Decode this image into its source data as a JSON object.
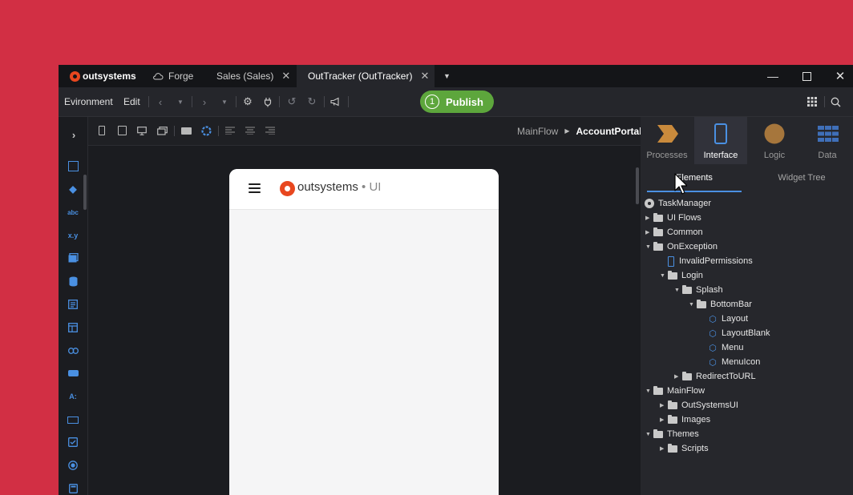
{
  "titlebar": {
    "brand": "outsystems",
    "tabs": [
      {
        "label": "Forge"
      },
      {
        "label": "Sales (Sales)"
      },
      {
        "label": "OutTracker (OutTracker)"
      }
    ]
  },
  "toolbar": {
    "environment_label": "Evironment",
    "edit_label": "Edit",
    "publish_number": "1",
    "publish_label": "Publish"
  },
  "breadcrumb": {
    "flow": "MainFlow",
    "screen": "AccountPortal"
  },
  "device": {
    "logo_text": "outsystems",
    "logo_suffix": " • UI"
  },
  "right_panel": {
    "tabs": [
      {
        "label": "Processes",
        "color": "#c98a3c"
      },
      {
        "label": "Interface",
        "color": "#4a90e2"
      },
      {
        "label": "Logic",
        "color": "#a6763c"
      },
      {
        "label": "Data",
        "color": "#3f6fb8"
      }
    ],
    "subtabs": [
      {
        "label": "Elements"
      },
      {
        "label": "Widget Tree"
      }
    ],
    "tree": [
      {
        "label": "TaskManager"
      },
      {
        "label": "UI Flows"
      },
      {
        "label": "Common"
      },
      {
        "label": "OnException"
      },
      {
        "label": "InvalidPermissions"
      },
      {
        "label": "Login"
      },
      {
        "label": "Splash"
      },
      {
        "label": "BottomBar"
      },
      {
        "label": "Layout"
      },
      {
        "label": "LayoutBlank"
      },
      {
        "label": "Menu"
      },
      {
        "label": "MenuIcon"
      },
      {
        "label": "RedirectToURL"
      },
      {
        "label": "MainFlow"
      },
      {
        "label": "OutSystemsUI"
      },
      {
        "label": "Images"
      },
      {
        "label": "Themes"
      },
      {
        "label": "Scripts"
      }
    ]
  },
  "colors": {
    "background": "#d22f44",
    "publish": "#5da63c",
    "accent": "#4a90e2",
    "brand": "#e8471f"
  }
}
